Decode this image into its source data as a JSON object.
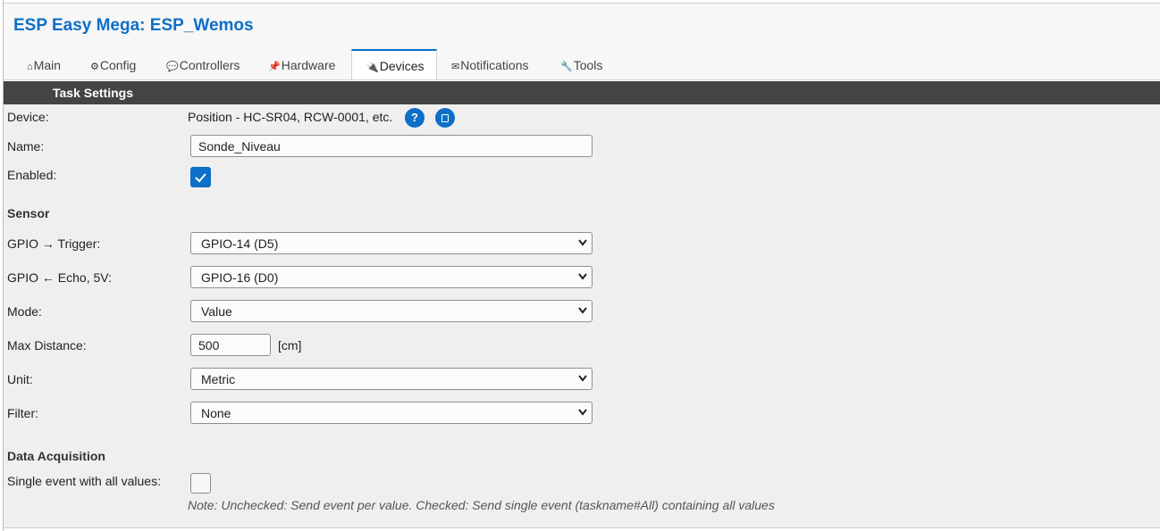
{
  "app": {
    "title": "ESP Easy Mega: ESP_Wemos"
  },
  "tabs": [
    {
      "icon": "home-icon",
      "glyph": "⌂",
      "label": "Main"
    },
    {
      "icon": "gear-icon",
      "glyph": "⚙",
      "label": "Config"
    },
    {
      "icon": "speech-bubble-icon",
      "glyph": "💬",
      "label": "Controllers"
    },
    {
      "icon": "pin-icon",
      "glyph": "📌",
      "label": "Hardware"
    },
    {
      "icon": "plug-icon",
      "glyph": "🔌",
      "label": "Devices",
      "active": true
    },
    {
      "icon": "envelope-icon",
      "glyph": "✉",
      "label": "Notifications"
    },
    {
      "icon": "wrench-icon",
      "glyph": "🔧",
      "label": "Tools"
    }
  ],
  "section_header": "Task Settings",
  "form": {
    "device": {
      "label": "Device:",
      "value": "Position - HC-SR04, RCW-0001, etc.",
      "help_icon": "question-icon",
      "doc_icon": "document-icon"
    },
    "name": {
      "label": "Name:",
      "value": "Sonde_Niveau"
    },
    "enabled": {
      "label": "Enabled:",
      "checked": true
    },
    "sensor_heading": "Sensor",
    "gpio_trigger": {
      "label": "GPIO → Trigger:",
      "value": "GPIO-14 (D5)"
    },
    "gpio_echo": {
      "label": "GPIO ← Echo, 5V:",
      "value": "GPIO-16 (D0)"
    },
    "mode": {
      "label": "Mode:",
      "value": "Value"
    },
    "max_distance": {
      "label": "Max Distance:",
      "value": "500",
      "unit": "[cm]"
    },
    "unit": {
      "label": "Unit:",
      "value": "Metric"
    },
    "filter": {
      "label": "Filter:",
      "value": "None"
    },
    "data_acq_heading": "Data Acquisition",
    "single_event": {
      "label": "Single event with all values:",
      "checked": false
    },
    "note": "Note: Unchecked: Send event per value. Checked: Send single event (taskname#All) containing all values"
  },
  "colors": {
    "accent": "#0d6fc7",
    "header_bar": "#444444",
    "content_bg": "#efefef"
  }
}
